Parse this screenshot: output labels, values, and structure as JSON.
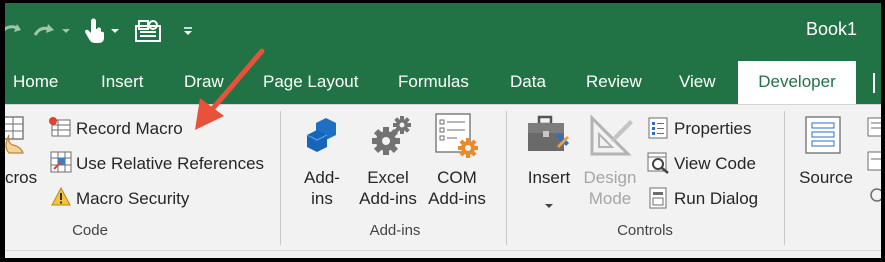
{
  "window": {
    "title": "Book1"
  },
  "tabs": [
    {
      "label": "Home"
    },
    {
      "label": "Insert"
    },
    {
      "label": "Draw"
    },
    {
      "label": "Page Layout"
    },
    {
      "label": "Formulas"
    },
    {
      "label": "Data"
    },
    {
      "label": "Review"
    },
    {
      "label": "View"
    },
    {
      "label": "Developer",
      "active": true
    }
  ],
  "code_group": {
    "label": "Code",
    "macros_partial": "cros",
    "record_macro": "Record Macro",
    "relative_references": "Use Relative References",
    "macro_security": "Macro Security"
  },
  "addins_group": {
    "label": "Add-ins",
    "addins_line1": "Add-",
    "addins_line2": "ins",
    "excel_line1": "Excel",
    "excel_line2": "Add-ins",
    "com_line1": "COM",
    "com_line2": "Add-ins"
  },
  "controls_group": {
    "label": "Controls",
    "insert": "Insert",
    "design_line1": "Design",
    "design_line2": "Mode",
    "properties": "Properties",
    "view_code": "View Code",
    "run_dialog": "Run Dialog"
  },
  "xml_group": {
    "source": "Source"
  },
  "colors": {
    "excel_green": "#217346",
    "annotation_arrow": "#e8523a"
  }
}
